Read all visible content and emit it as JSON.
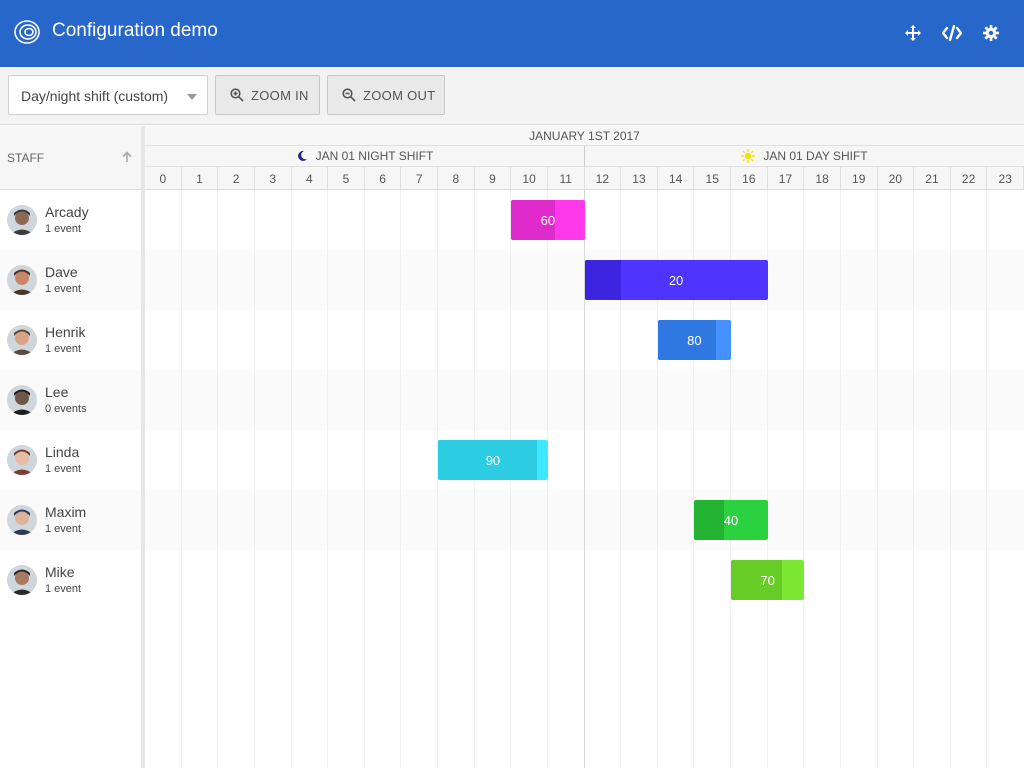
{
  "header": {
    "title": "Configuration demo",
    "icons": [
      "logo-icon",
      "move-icon",
      "code-icon",
      "settings-icon"
    ]
  },
  "toolbar": {
    "preset": {
      "value": "Day/night shift (custom)"
    },
    "zoom_in": "ZOOM IN",
    "zoom_out": "ZOOM OUT"
  },
  "grid": {
    "staff_header": "STAFF",
    "date_header": "JANUARY 1ST 2017",
    "night_shift": "JAN 01 NIGHT SHIFT",
    "day_shift": "JAN 01 DAY SHIFT",
    "hours": [
      "0",
      "1",
      "2",
      "3",
      "4",
      "5",
      "6",
      "7",
      "8",
      "9",
      "10",
      "11",
      "12",
      "13",
      "14",
      "15",
      "16",
      "17",
      "18",
      "19",
      "20",
      "21",
      "22",
      "23"
    ]
  },
  "resources": [
    {
      "name": "Arcady",
      "events": "1 event"
    },
    {
      "name": "Dave",
      "events": "1 event"
    },
    {
      "name": "Henrik",
      "events": "1 event"
    },
    {
      "name": "Lee",
      "events": "0 events"
    },
    {
      "name": "Linda",
      "events": "1 event"
    },
    {
      "name": "Maxim",
      "events": "1 event"
    },
    {
      "name": "Mike",
      "events": "1 event"
    }
  ],
  "events": [
    {
      "resource": 0,
      "start": 10,
      "end": 12,
      "label": "60",
      "percent": 60,
      "color": "#ff38e9",
      "dark": "#e02bcc"
    },
    {
      "resource": 1,
      "start": 12,
      "end": 17,
      "label": "20",
      "percent": 20,
      "color": "#4f34ff",
      "dark": "#3b25e0"
    },
    {
      "resource": 2,
      "start": 14,
      "end": 16,
      "label": "80",
      "percent": 80,
      "color": "#4591ff",
      "dark": "#2f78e2"
    },
    {
      "resource": 4,
      "start": 8,
      "end": 11,
      "label": "90",
      "percent": 90,
      "color": "#3de8ff",
      "dark": "#2ccde3"
    },
    {
      "resource": 5,
      "start": 15,
      "end": 17,
      "label": "40",
      "percent": 40,
      "color": "#2bd13e",
      "dark": "#22b431"
    },
    {
      "resource": 6,
      "start": 16,
      "end": 18,
      "label": "70",
      "percent": 70,
      "color": "#7de833",
      "dark": "#68cc27"
    }
  ]
}
